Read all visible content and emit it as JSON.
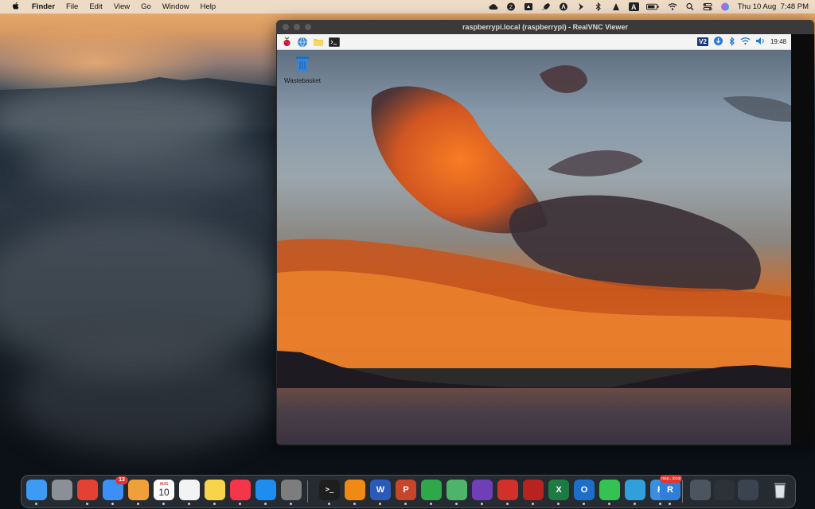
{
  "menubar": {
    "app_name": "Finder",
    "menus": [
      "File",
      "Edit",
      "View",
      "Go",
      "Window",
      "Help"
    ],
    "status_icons": [
      "creative-cloud-icon",
      "app-2-icon",
      "drive-icon",
      "rocket-icon",
      "app-icon",
      "arrow-icon",
      "bluetooth-icon",
      "vlc-icon",
      "a-icon",
      "battery-icon",
      "wifi-icon",
      "search-icon",
      "control-center-icon",
      "siri-icon"
    ],
    "keyboard_label": "A",
    "datetime": "Thu 10 Aug  7:48 PM"
  },
  "vnc_window": {
    "title": "raspberrypi.local (raspberrypi) - RealVNC Viewer",
    "pi_panel": {
      "clock": "19:48",
      "vnc_tray_label": "V2"
    },
    "desktop_icon": {
      "label": "Wastebasket"
    }
  },
  "dock": {
    "items": [
      {
        "name": "finder",
        "color": "#3d9bf3",
        "label": ""
      },
      {
        "name": "launchpad",
        "color": "#8a8f98",
        "label": ""
      },
      {
        "name": "chrome",
        "color": "#e44134",
        "label": ""
      },
      {
        "name": "mail",
        "color": "#3d8ef5",
        "label": "",
        "badge": "13"
      },
      {
        "name": "photos",
        "color": "#f0a03a",
        "label": ""
      },
      {
        "name": "calendar",
        "color": "#ffffff",
        "label": "10",
        "sublabel": "AUG"
      },
      {
        "name": "reminders",
        "color": "#f3f3f3",
        "label": ""
      },
      {
        "name": "notes",
        "color": "#f8d548",
        "label": ""
      },
      {
        "name": "music",
        "color": "#f5354a",
        "label": ""
      },
      {
        "name": "app-store",
        "color": "#1d8ef0",
        "label": ""
      },
      {
        "name": "system-settings",
        "color": "#7d7d7d",
        "label": ""
      },
      {
        "name": "terminal",
        "color": "#1e1e1e",
        "label": ">_"
      },
      {
        "name": "vlc",
        "color": "#f08a12",
        "label": ""
      },
      {
        "name": "word",
        "color": "#2b5bb8",
        "label": "W"
      },
      {
        "name": "powerpoint",
        "color": "#c9452a",
        "label": "P"
      },
      {
        "name": "evernote",
        "color": "#2fa84a",
        "label": ""
      },
      {
        "name": "atom",
        "color": "#4fb46b",
        "label": ""
      },
      {
        "name": "github-desktop",
        "color": "#6f3fb7",
        "label": ""
      },
      {
        "name": "acrobat",
        "color": "#d2302a",
        "label": ""
      },
      {
        "name": "pdf-expert",
        "color": "#b8231f",
        "label": ""
      },
      {
        "name": "excel",
        "color": "#1e7a43",
        "label": "X"
      },
      {
        "name": "outlook",
        "color": "#1c6fc9",
        "label": "O"
      },
      {
        "name": "whatsapp",
        "color": "#35c254",
        "label": ""
      },
      {
        "name": "telegram",
        "color": "#2fa0dc",
        "label": ""
      },
      {
        "name": "realvnc",
        "color": "#3a8fe0",
        "label": "R"
      },
      {
        "name": "raspberrypi-local",
        "color": "#2f7fd8",
        "label": "R",
        "badge": "rasp...local"
      },
      {
        "name": "downloads-stack",
        "color": "#4a5560",
        "label": ""
      },
      {
        "name": "recent-window-1",
        "color": "#2c3238",
        "label": ""
      },
      {
        "name": "recent-window-2",
        "color": "#3a4450",
        "label": ""
      },
      {
        "name": "trash",
        "color": "#b8bcc2",
        "label": ""
      }
    ]
  }
}
